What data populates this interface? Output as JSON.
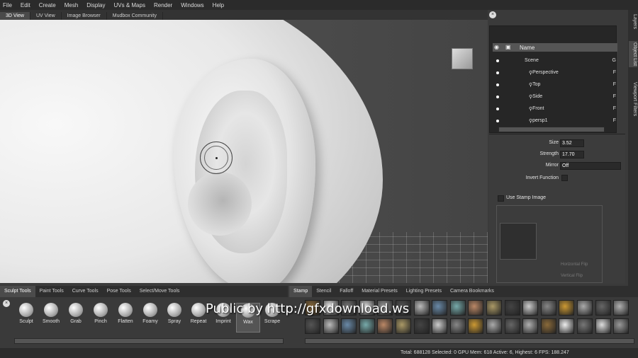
{
  "menu": [
    "File",
    "Edit",
    "Create",
    "Mesh",
    "Display",
    "UVs & Maps",
    "Render",
    "Windows",
    "Help"
  ],
  "view_tabs": [
    "3D View",
    "UV View",
    "Image Browser",
    "Mudbox Community"
  ],
  "right_tabs": [
    "Layers",
    "Object List",
    "Viewport Filters"
  ],
  "outliner": {
    "header": "Name",
    "rows": [
      "Scene",
      "Perspective",
      "Top",
      "Side",
      "Front",
      "persp1"
    ],
    "row_suffix": [
      "G",
      "F",
      "F",
      "F",
      "F",
      "F"
    ]
  },
  "props": {
    "size_label": "Size",
    "size_value": "3.52",
    "strength_label": "Strength",
    "strength_value": "17.70",
    "mirror_label": "Mirror",
    "mirror_value": "Off",
    "invert_label": "Invert Function",
    "stamp_label": "Use Stamp Image",
    "h_flip": "Horizontal Flip",
    "v_flip": "Vertical Flip"
  },
  "tool_tabs": [
    "Sculpt Tools",
    "Paint Tools",
    "Curve Tools",
    "Pose Tools",
    "Select/Move Tools"
  ],
  "tools": [
    "Sculpt",
    "Smooth",
    "Grab",
    "Pinch",
    "Flatten",
    "Foamy",
    "Spray",
    "Repeat",
    "Imprint",
    "Wax",
    "Scrape"
  ],
  "stamp_tabs": [
    "Stamp",
    "Stencil",
    "Falloff",
    "Material Presets",
    "Lighting Presets",
    "Camera Bookmarks"
  ],
  "watermark": "Public by http://gfxdownload.ws",
  "status": "Total: 688128  Selected: 0 GPU Mem: 618  Active: 6, Highest: 6  FPS: 188.247",
  "colors": {
    "bg": "#3c3c3c",
    "panel": "#262626",
    "accent": "#4b4b4b"
  }
}
